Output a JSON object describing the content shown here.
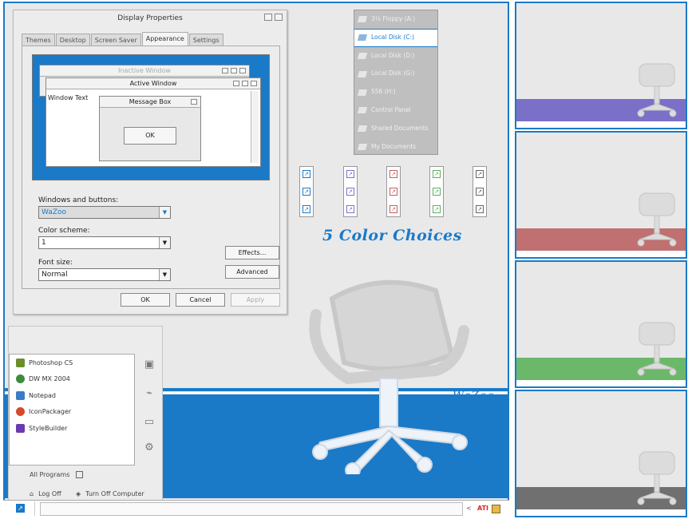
{
  "dialog": {
    "title": "Display Properties",
    "tabs": [
      "Themes",
      "Desktop",
      "Screen Saver",
      "Appearance",
      "Settings"
    ],
    "active_tab": "Appearance",
    "preview": {
      "inactive_title": "Inactive Window",
      "active_title": "Active Window",
      "window_text": "Window Text",
      "message_box_title": "Message Box",
      "message_ok": "OK"
    },
    "windows_buttons_label": "Windows and buttons:",
    "windows_buttons_value": "WaZoo",
    "color_scheme_label": "Color scheme:",
    "color_scheme_value": "1",
    "font_size_label": "Font size:",
    "font_size_value": "Normal",
    "effects_button": "Effects...",
    "advanced_button": "Advanced",
    "ok_button": "OK",
    "cancel_button": "Cancel",
    "apply_button": "Apply"
  },
  "drives": [
    {
      "label": "3½ Floppy (A:)",
      "selected": false
    },
    {
      "label": "Local Disk (C:)",
      "selected": true
    },
    {
      "label": "Local Disk (D:)",
      "selected": false
    },
    {
      "label": "Local Disk (G:)",
      "selected": false
    },
    {
      "label": "S56 (H:)",
      "selected": false
    },
    {
      "label": "Control Panel",
      "selected": false
    },
    {
      "label": "Shared Documents",
      "selected": false
    },
    {
      "label": "My Documents",
      "selected": false
    }
  ],
  "color_icons": [
    "#1a7ac8",
    "#7b70c8",
    "#c06060",
    "#5cb060",
    "#666666"
  ],
  "banner": "5 Color Choices",
  "desktop_logo": "WaZoo",
  "start_menu": {
    "programs": [
      {
        "label": "Photoshop CS",
        "color": "#6a8f2a"
      },
      {
        "label": "DW MX 2004",
        "color": "#3e8a3e"
      },
      {
        "label": "Notepad",
        "color": "#3a7cc4"
      },
      {
        "label": "IconPackager",
        "color": "#d44a2a"
      },
      {
        "label": "StyleBuilder",
        "color": "#6a3ab0"
      }
    ],
    "all_programs": "All Programs",
    "log_off": "Log Off",
    "turn_off": "Turn Off Computer"
  },
  "tray": {
    "brand": "ATI"
  },
  "thumbnails": [
    {
      "color": "#7b70c8"
    },
    {
      "color": "#c07070"
    },
    {
      "color": "#6cb86a"
    },
    {
      "color": "#707070"
    }
  ]
}
